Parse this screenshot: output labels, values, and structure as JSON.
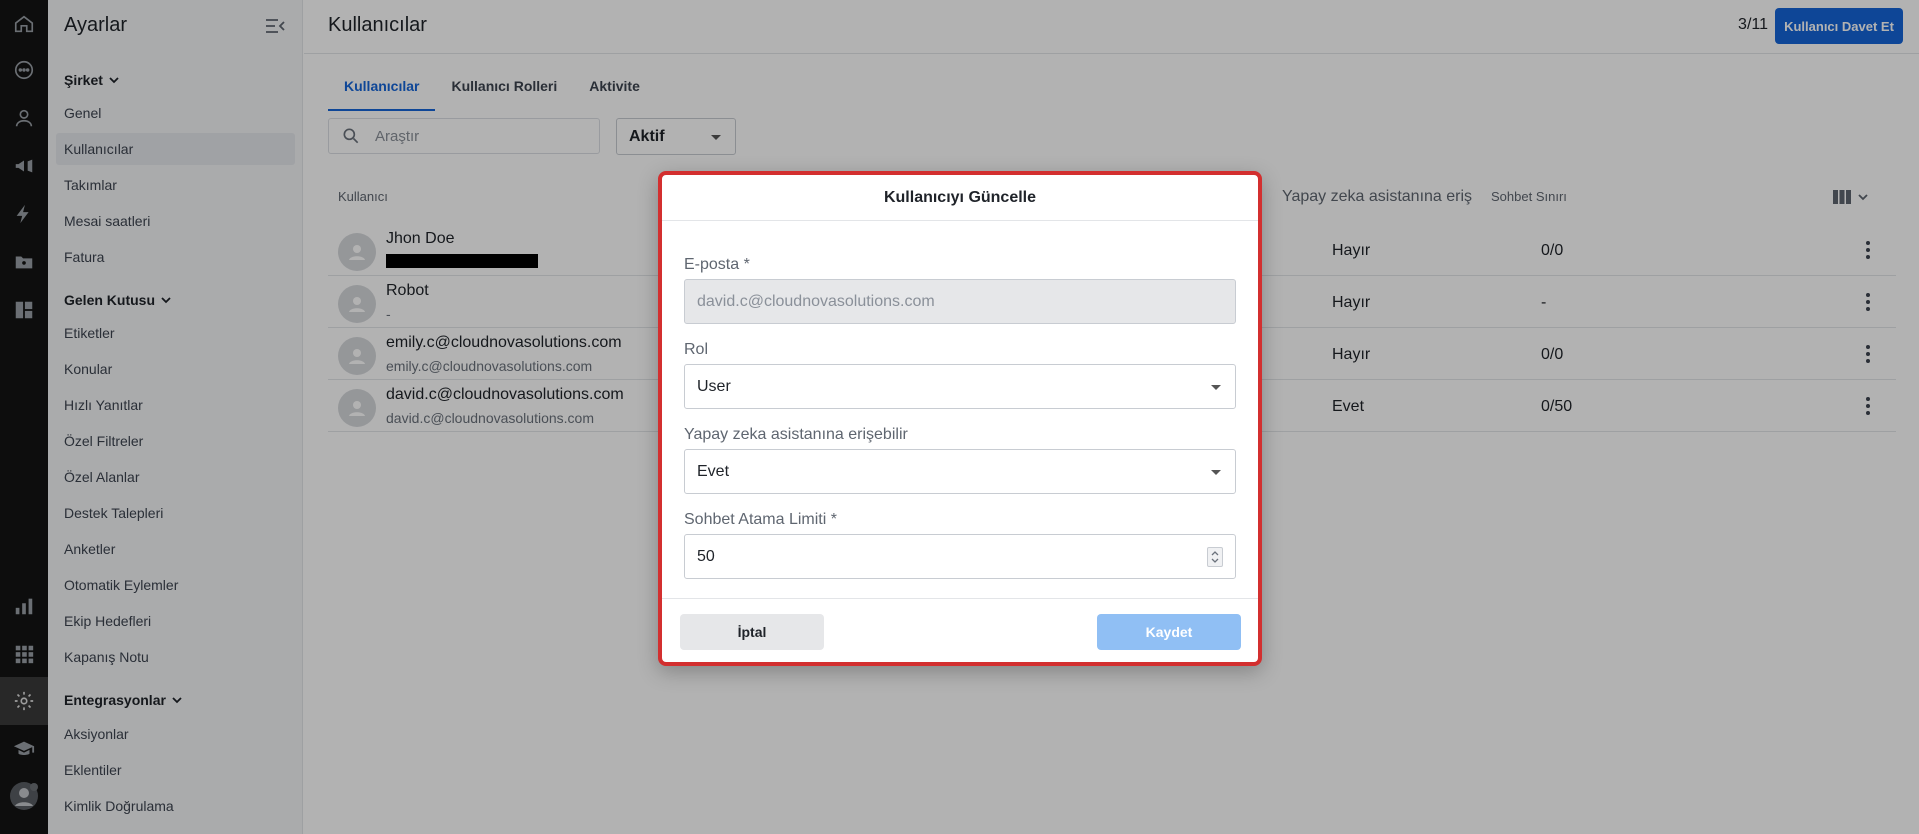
{
  "sidebar": {
    "title": "Ayarlar",
    "sections": [
      {
        "label": "Şirket",
        "items": [
          "Genel",
          "Kullanıcılar",
          "Takımlar",
          "Mesai saatleri",
          "Fatura"
        ]
      },
      {
        "label": "Gelen Kutusu",
        "items": [
          "Etiketler",
          "Konular",
          "Hızlı Yanıtlar",
          "Özel Filtreler",
          "Özel Alanlar",
          "Destek Talepleri",
          "Anketler",
          "Otomatik Eylemler",
          "Ekip Hedefleri",
          "Kapanış Notu"
        ]
      },
      {
        "label": "Entegrasyonlar",
        "items": [
          "Aksiyonlar",
          "Eklentiler",
          "Kimlik Doğrulama"
        ]
      }
    ],
    "active_item": "Kullanıcılar"
  },
  "header": {
    "title": "Kullanıcılar",
    "count": "3/11",
    "invite_button": "Kullanıcı Davet Et"
  },
  "tabs": [
    "Kullanıcılar",
    "Kullanıcı Rolleri",
    "Aktivite"
  ],
  "active_tab": "Kullanıcılar",
  "filters": {
    "search_placeholder": "Araştır",
    "status_value": "Aktif"
  },
  "table": {
    "headers": {
      "user": "Kullanıcı",
      "ai_access": "Yapay zeka asistanına eriş",
      "chat_limit": "Sohbet Sınırı"
    },
    "rows": [
      {
        "name": "Jhon Doe",
        "sub": "",
        "ai": "Hayır",
        "limit": "0/0",
        "redacted": true
      },
      {
        "name": "Robot",
        "sub": "-",
        "ai": "Hayır",
        "limit": "-",
        "redacted": false
      },
      {
        "name": "emily.c@cloudnovasolutions.com",
        "sub": "emily.c@cloudnovasolutions.com",
        "ai": "Hayır",
        "limit": "0/0",
        "redacted": false
      },
      {
        "name": "david.c@cloudnovasolutions.com",
        "sub": "david.c@cloudnovasolutions.com",
        "ai": "Evet",
        "limit": "0/50",
        "redacted": false
      }
    ]
  },
  "modal": {
    "title": "Kullanıcıyı Güncelle",
    "email_label": "E-posta",
    "email_value": "david.c@cloudnovasolutions.com",
    "role_label": "Rol",
    "role_value": "User",
    "ai_label": "Yapay zeka asistanına erişebilir",
    "ai_value": "Evet",
    "limit_label": "Sohbet Atama Limiti",
    "limit_value": "50",
    "required_mark": "*",
    "cancel_label": "İptal",
    "save_label": "Kaydet"
  },
  "colors": {
    "primary": "#1565d8",
    "save_disabled": "#90bff4",
    "modal_outline": "#d32f2f",
    "rail_bg": "#141414"
  },
  "icons": {
    "rail": [
      "home-icon",
      "chat-icon",
      "contacts-icon",
      "megaphone-icon",
      "bolt-icon",
      "folder-user-icon",
      "dashboard-icon",
      "bar-chart-icon",
      "apps-grid-icon",
      "gear-icon",
      "graduation-cap-icon",
      "profile-avatar-icon"
    ]
  }
}
